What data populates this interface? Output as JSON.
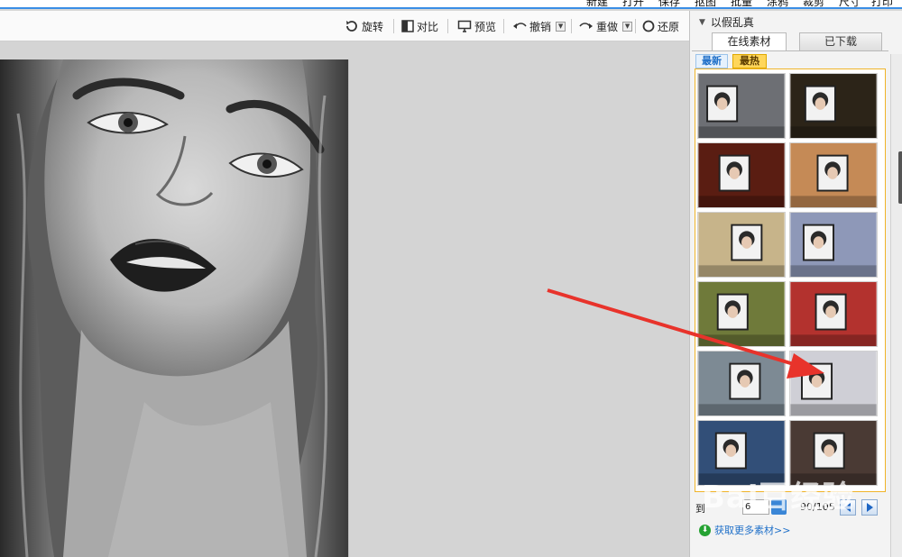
{
  "menubar": {
    "items": [
      "新建",
      "打开",
      "保存",
      "抠图",
      "批量",
      "涂鸦",
      "裁剪",
      "尺寸",
      "打印"
    ]
  },
  "toolbar": {
    "rotate": "旋转",
    "compare": "对比",
    "preview": "预览",
    "undo": "撤销",
    "redo": "重做",
    "restore": "还原"
  },
  "panel": {
    "title": "以假乱真",
    "tab_online": "在线素材",
    "tab_downloaded": "已下载",
    "subtab_new": "最新",
    "subtab_hot": "最热",
    "pager": {
      "label": "到",
      "page_value": "6",
      "count": "90/105"
    },
    "more_link": "获取更多素材>>"
  },
  "thumbnails": [
    {
      "name": "bus-stop-billboard",
      "bg": "#6d6f74"
    },
    {
      "name": "night-street-poster",
      "bg": "#2c2418"
    },
    {
      "name": "red-kiosk-poster",
      "bg": "#5a1d12"
    },
    {
      "name": "heart-hands",
      "bg": "#c58a56"
    },
    {
      "name": "building-poster",
      "bg": "#c7b48a"
    },
    {
      "name": "billboard-tower",
      "bg": "#8e98b8"
    },
    {
      "name": "green-room-poster",
      "bg": "#6f7a3a"
    },
    {
      "name": "train-windows",
      "bg": "#b3322e"
    },
    {
      "name": "dome-screen",
      "bg": "#7d8a94"
    },
    {
      "name": "welcome-banner",
      "bg": "#cfcfd6"
    },
    {
      "name": "stage-screen",
      "bg": "#324f78"
    },
    {
      "name": "storefront-poster",
      "bg": "#4a3a34"
    }
  ],
  "watermark": "Bai百经验",
  "colors": {
    "accent": "#3a8ee6",
    "hot_tab": "#ffd65a",
    "grid_border": "#f0b429",
    "arrow": "#e8332b"
  }
}
